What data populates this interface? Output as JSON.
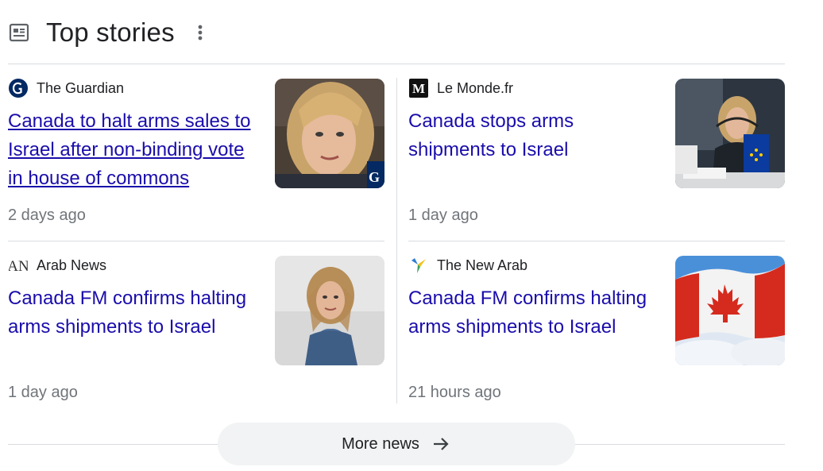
{
  "header": {
    "title": "Top stories",
    "icon": "newspaper-icon",
    "menu_icon": "more-vert-icon"
  },
  "stories": [
    {
      "source": "The Guardian",
      "logo": "guardian-logo-icon",
      "headline": "Canada to halt arms sales to Israel after non-binding vote in house of commons",
      "age": "2 days ago",
      "visited": true
    },
    {
      "source": "Le Monde.fr",
      "logo": "le-monde-logo-icon",
      "logo_text": "M",
      "headline": "Canada stops arms shipments to Israel",
      "age": "1 day ago",
      "visited": false
    },
    {
      "source": "Arab News",
      "logo": "arab-news-logo-icon",
      "logo_text": "AN",
      "headline": "Canada FM confirms halting arms shipments to Israel",
      "age": "1 day ago",
      "visited": false
    },
    {
      "source": "The New Arab",
      "logo": "new-arab-logo-icon",
      "headline": "Canada FM confirms halting arms shipments to Israel",
      "age": "21 hours ago",
      "visited": false
    }
  ],
  "more_button": {
    "label": "More news",
    "icon": "arrow-right-icon"
  },
  "colors": {
    "link": "#1a0dab",
    "meta": "#70757a",
    "divider": "#dadce0",
    "button_bg": "#f1f3f4"
  }
}
